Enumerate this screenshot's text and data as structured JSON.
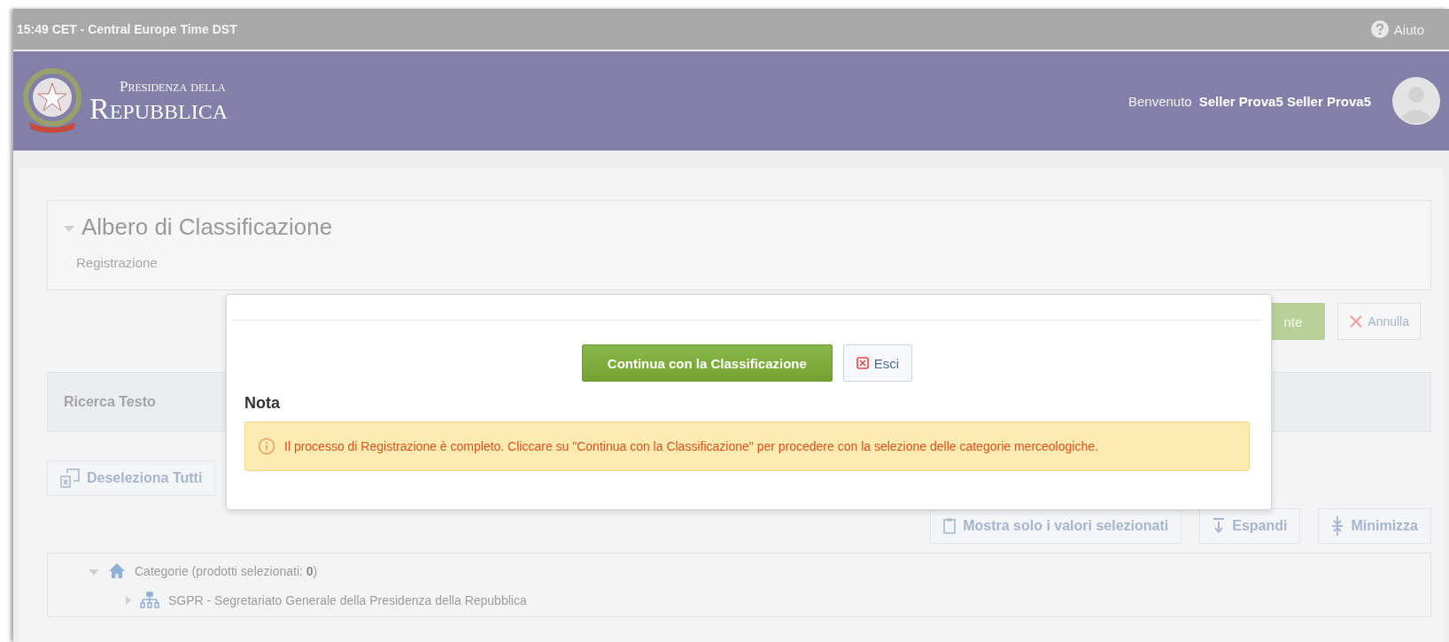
{
  "top_bar": {
    "time": "15:49 CET - Central Europe Time DST",
    "help": "Aiuto"
  },
  "header": {
    "logo_line1": "Presidenza della",
    "logo_line2": "Repubblica",
    "welcome": "Benvenuto",
    "user": "Seller Prova5 Seller Prova5"
  },
  "section": {
    "title": "Albero di Classificazione",
    "subtitle": "Registrazione",
    "expanded": true
  },
  "actions": [
    {
      "kind": "primary",
      "label": "nte"
    },
    {
      "kind": "cancel",
      "label": "Annulla"
    }
  ],
  "search_panel": {
    "title": "Ricerca Testo"
  },
  "deselect_button": "Deseleziona Tutti",
  "tree_tools": [
    {
      "kind": "show",
      "label": "Mostra solo i valori selezionati"
    },
    {
      "kind": "expand",
      "label": "Espandi"
    },
    {
      "kind": "collapse",
      "label": "Minimizza"
    }
  ],
  "tree": [
    {
      "kind": "home",
      "label": "Categorie (prodotti selezionati: **0**)",
      "expanded": true,
      "children": [
        {
          "kind": "org",
          "label": "SGPR - Segretariato Generale della Presidenza della Repubblica",
          "expanded": false
        }
      ]
    }
  ],
  "modal": {
    "primary_button": "Continua con la Classificazione",
    "exit_button": "Esci",
    "note_title": "Nota",
    "alert": "Il processo di Registrazione è completo. Cliccare su \"Continua con la Classificazione\" per procedere con la selezione delle categorie merceologiche."
  }
}
